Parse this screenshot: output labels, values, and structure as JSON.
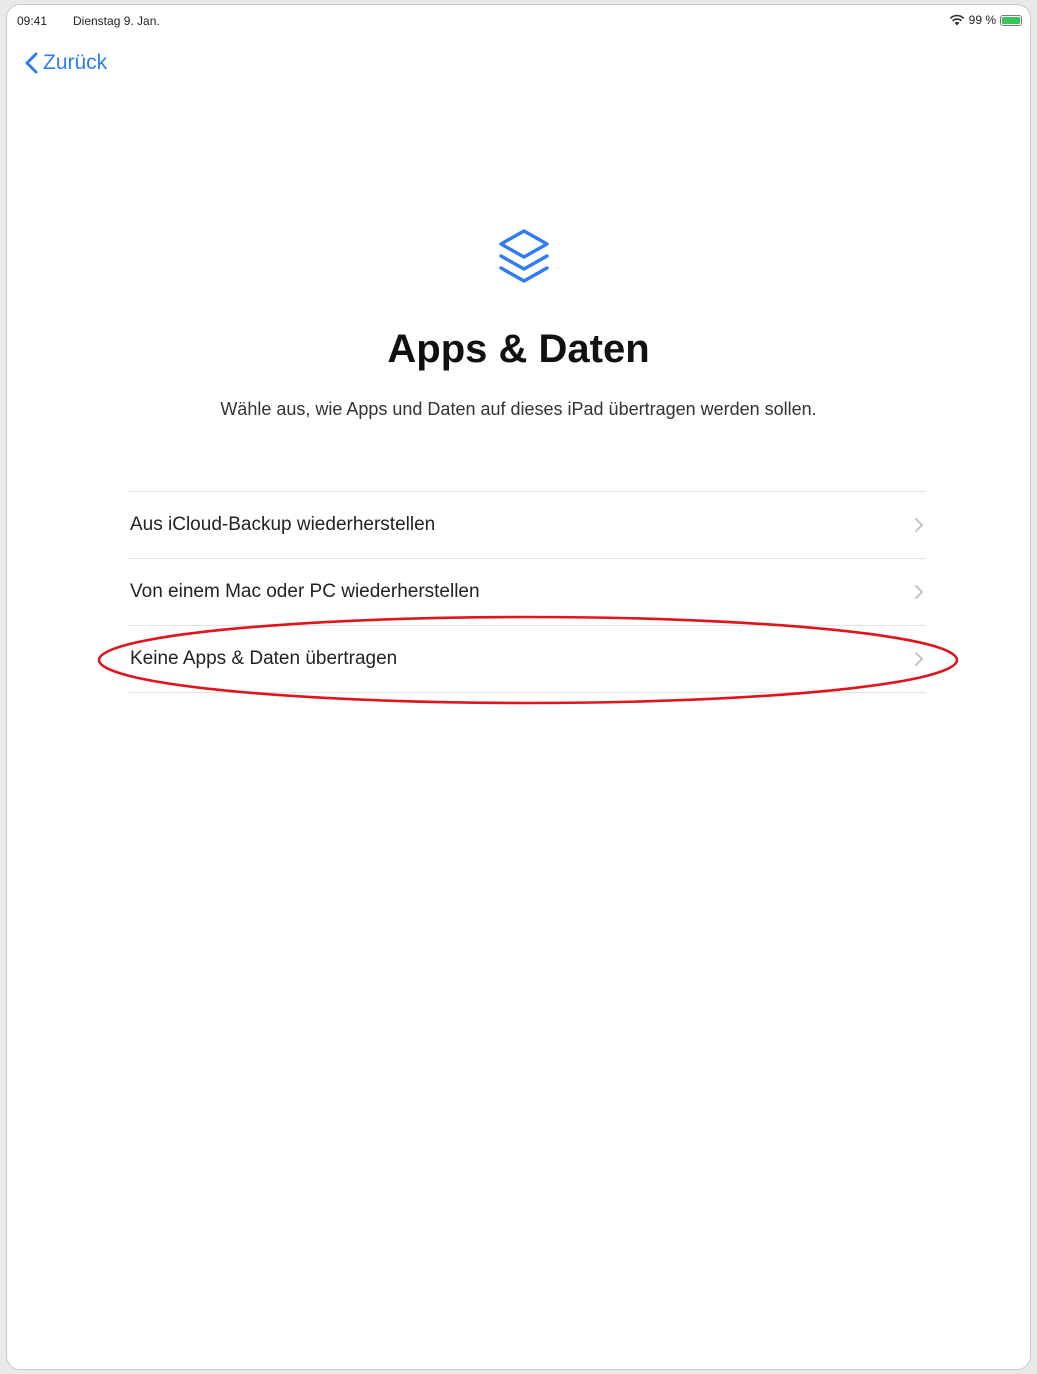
{
  "status_bar": {
    "time": "09:41",
    "date": "Dienstag 9. Jan.",
    "battery_percent": "99 %",
    "battery_level": 0.99,
    "icons": [
      "wifi-icon",
      "battery-icon"
    ]
  },
  "nav": {
    "back_label": "Zurück",
    "back_icon": "chevron-left-icon"
  },
  "header": {
    "icon": "stacked-layers-icon",
    "title": "Apps & Daten",
    "subtitle": "Wähle aus, wie Apps und Daten auf dieses iPad übertragen werden sollen."
  },
  "options": [
    {
      "label": "Aus iCloud-Backup wiederherstellen",
      "icon": "chevron-right-icon"
    },
    {
      "label": "Von einem Mac oder PC wiederherstellen",
      "icon": "chevron-right-icon"
    },
    {
      "label": "Keine Apps & Daten übertragen",
      "icon": "chevron-right-icon",
      "highlighted": true
    }
  ],
  "colors": {
    "accent": "#2f7cf6",
    "highlight_annotation": "#e0141b",
    "battery": "#37c759"
  }
}
